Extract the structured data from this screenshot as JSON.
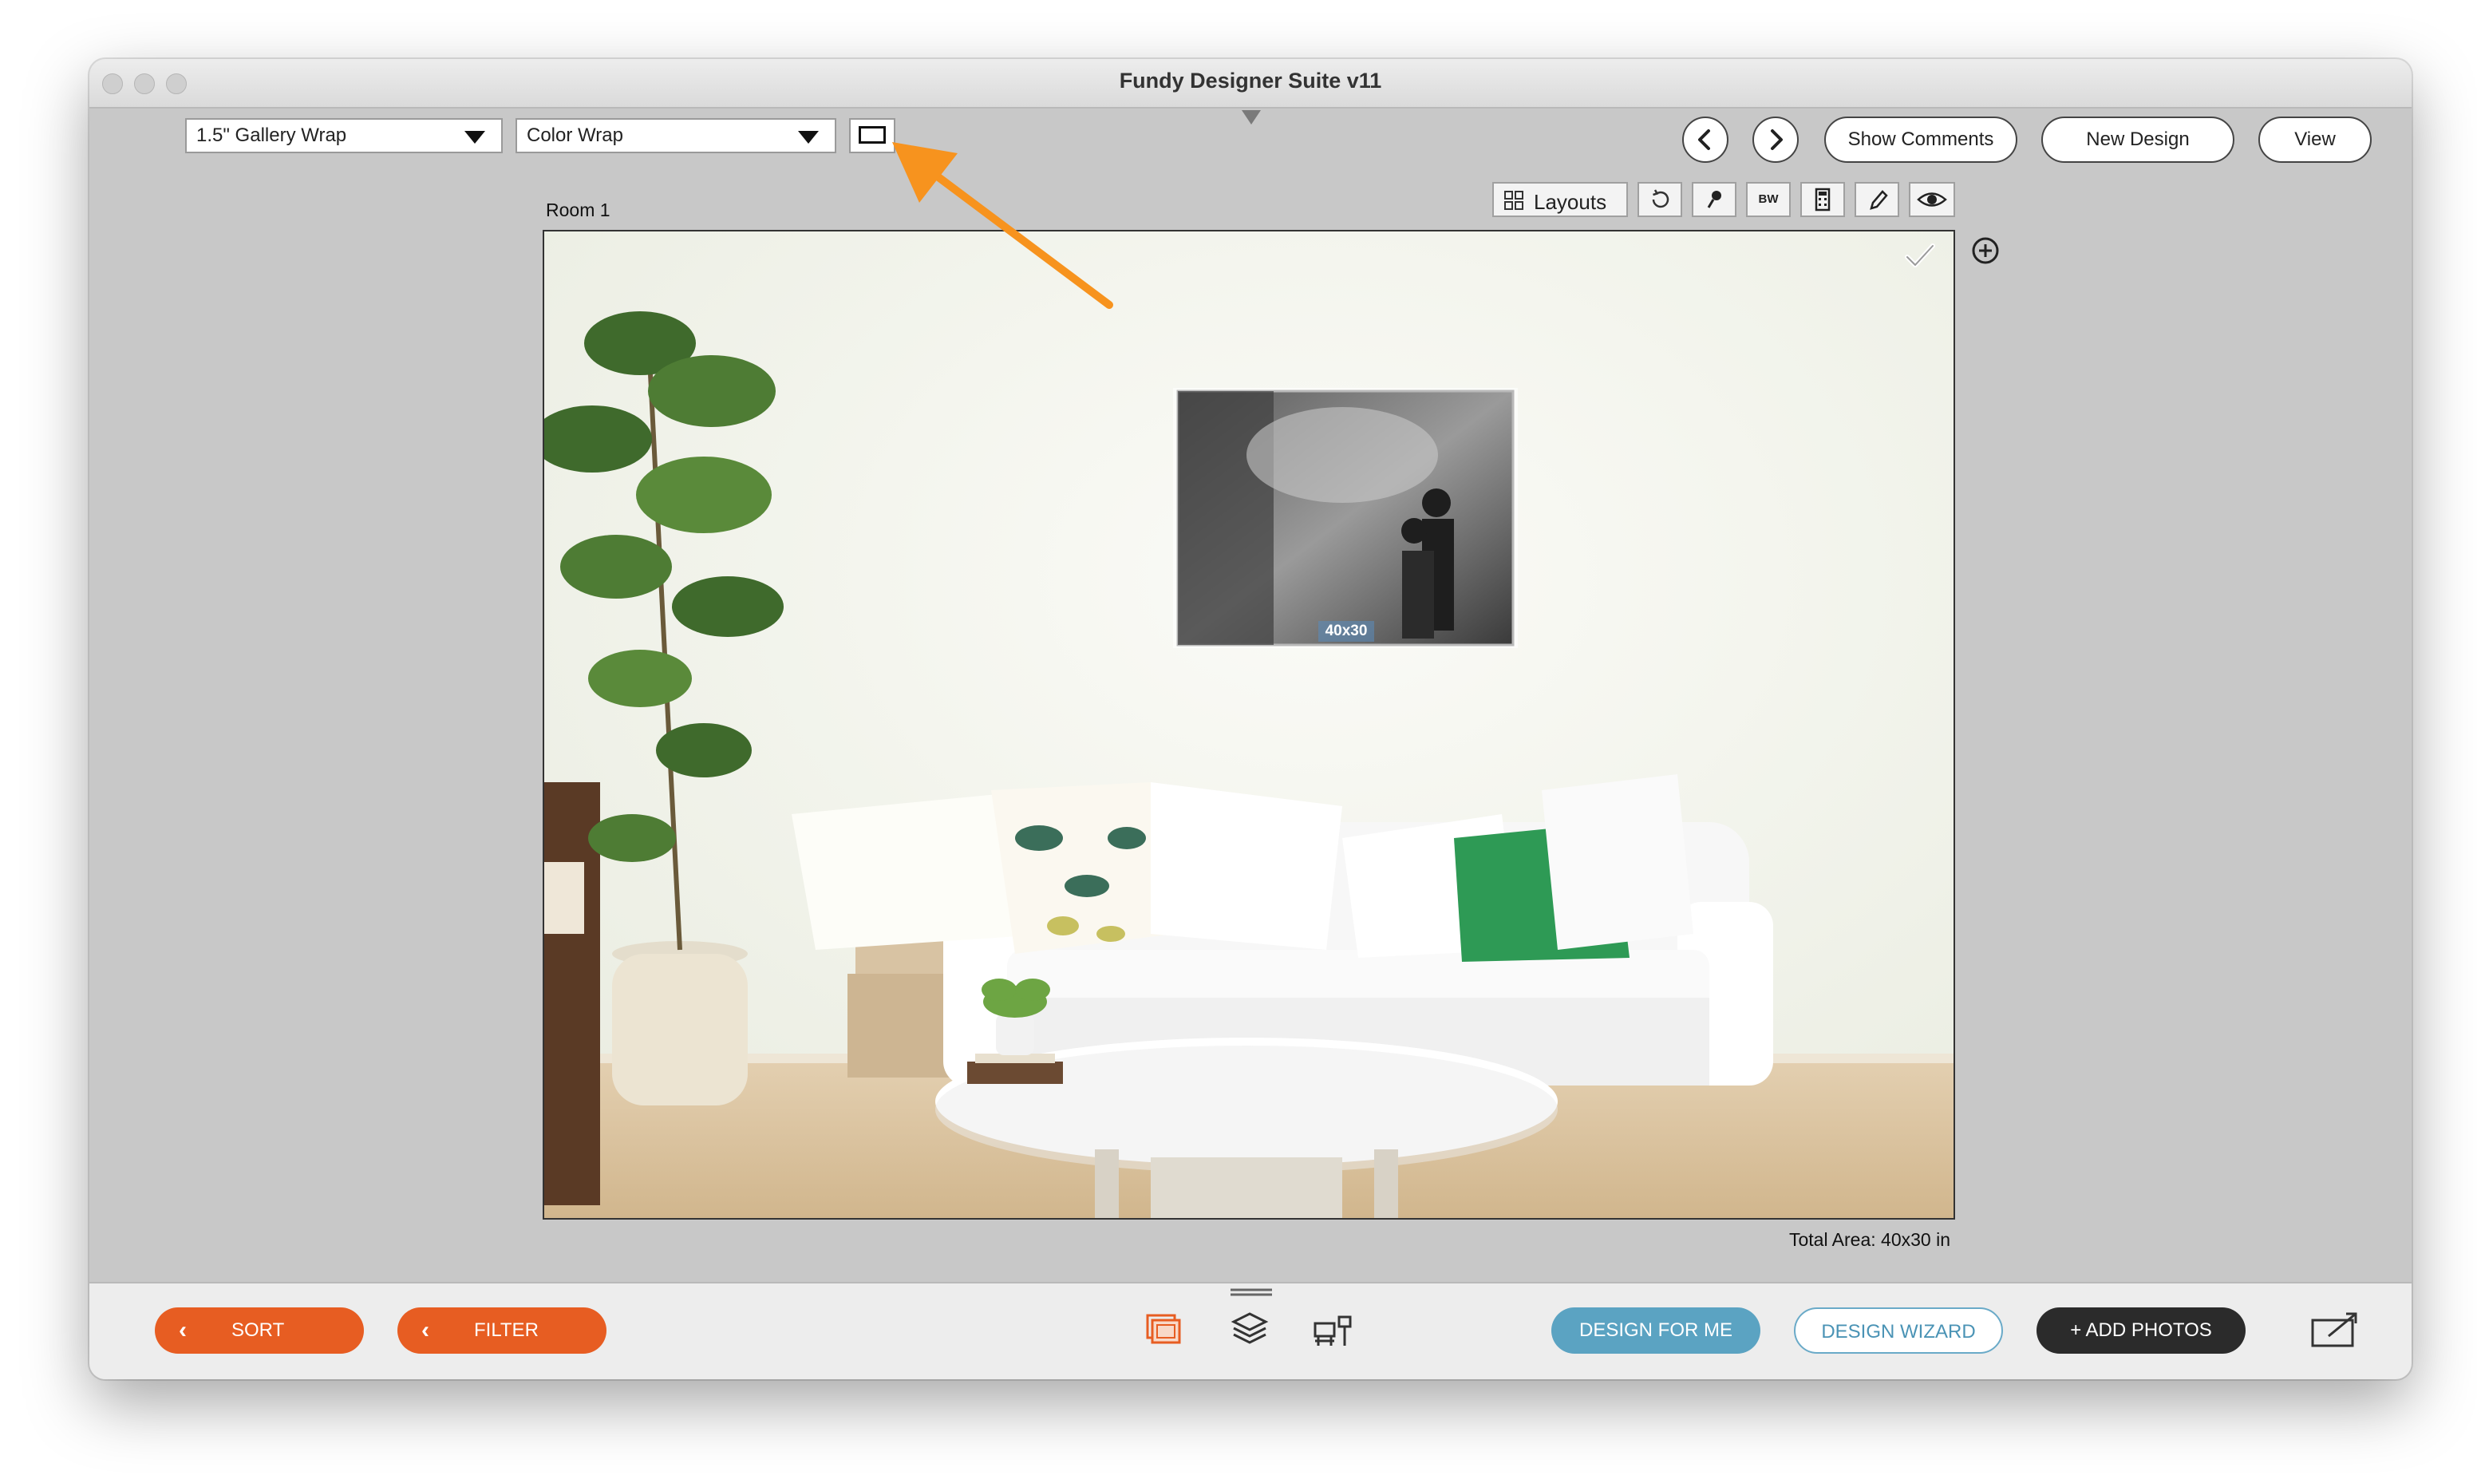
{
  "window": {
    "title": "Fundy Designer Suite v11"
  },
  "toolbar": {
    "product_select": "1.5\" Gallery Wrap",
    "wrap_select": "Color Wrap",
    "show_comments": "Show Comments",
    "new_design": "New Design",
    "view": "View",
    "layouts": "Layouts",
    "bw": "BW"
  },
  "canvas": {
    "room_label": "Room 1",
    "photo_size_label": "40x30",
    "total_area": "Total Area: 40x30 in"
  },
  "bottom": {
    "sort": "SORT",
    "filter": "FILTER",
    "design_for_me": "DESIGN FOR ME",
    "design_wizard": "DESIGN WIZARD",
    "add_photos": "+ ADD PHOTOS"
  },
  "colors": {
    "accent_orange": "#e75d22",
    "design_for_me_blue": "#5ba3c2",
    "wizard_outline": "#6aaac8",
    "dark_button": "#2b2b2b",
    "annotation_arrow": "#f7931e"
  }
}
